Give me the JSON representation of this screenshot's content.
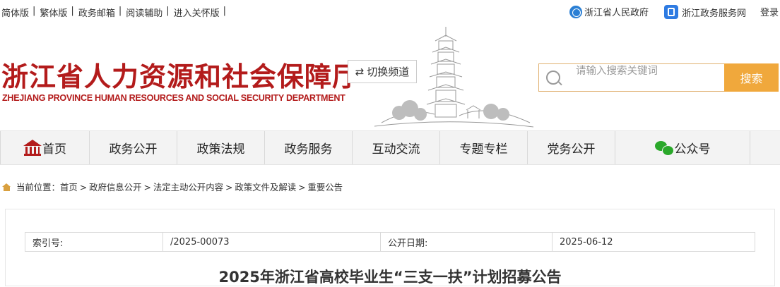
{
  "topbar": {
    "links": [
      "简体版",
      "繁体版",
      "政务邮箱",
      "阅读辅助",
      "进入关怀版"
    ],
    "gov_link": "浙江省人民政府",
    "service_link": "浙江政务服务网",
    "login": "登录"
  },
  "header": {
    "title": "浙江省人力资源和社会保障厅",
    "subtitle": "ZHEJIANG PROVINCE HUMAN RESOURCES AND SOCIAL SECURITY DEPARTMENT",
    "switch_channel": "切换频道",
    "search_placeholder": "请输入搜索关键词",
    "search_button": "搜索"
  },
  "nav": {
    "items": [
      "首页",
      "政务公开",
      "政策法规",
      "政务服务",
      "互动交流",
      "专题专栏",
      "党务公开",
      "公众号"
    ]
  },
  "breadcrumb": {
    "label": "当前位置：",
    "items": [
      "首页",
      "政府信息公开",
      "法定主动公开内容",
      "政策文件及解读",
      "重要公告"
    ]
  },
  "meta": {
    "index_label": "索引号:",
    "index_value": "/2025-00073",
    "date_label": "公开日期:",
    "date_value": "2025-06-12"
  },
  "article": {
    "title": "2025年浙江省高校毕业生“三支一扶”计划招募公告"
  },
  "colors": {
    "brand_red": "#b31b1b",
    "search_orange": "#f0a83c",
    "nav_bg": "#f3f3f3"
  }
}
